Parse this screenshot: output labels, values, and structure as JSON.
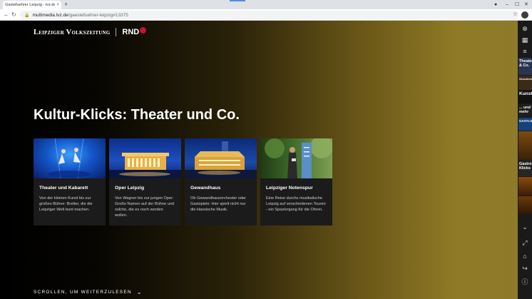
{
  "browser": {
    "tab_title": "Gastefuehrer Leipzig - lvz.de",
    "tab_close": "×",
    "new_tab": "+",
    "url_host": "multimedia.lvz.de",
    "url_path": "/gaestefuehrer-leipzig#13375",
    "icons": {
      "back": "←",
      "reload": "↻",
      "lock": "🔒",
      "star": "☆",
      "minimize": "–",
      "maximize": "☐",
      "close": "✕",
      "record": "●"
    }
  },
  "brand": {
    "lvz": "Leipziger Volkszeitung",
    "rnd": "RND"
  },
  "headline": "Kultur-Klicks: Theater und Co.",
  "cards": [
    {
      "title": "Theater und Kabarett",
      "text": "Von der kleinen Kunst bis zur großen Bühne: Bretter, die die Leipziger Welt bunt machen."
    },
    {
      "title": "Oper Leipzig",
      "text": "Von Wagner bis zur jungen Oper: Große Namen auf der Bühne und solche, die es noch werden wollen."
    },
    {
      "title": "Gewandhaus",
      "text": "Ob Gewandhausorchester oder Gastspiele: Hier spielt nicht nur die klassische Musik."
    },
    {
      "title": "Leipziger Notenspur",
      "text": "Eine Reise durchs musikalische Leipzig auf verschiedenen Touren - ein Spaziergang für die Ohren."
    }
  ],
  "scroll_hint": "SCROLLEN, UM WEITERZULESEN",
  "scroll_chevron": "⌄",
  "sidebar": {
    "top_icons": [
      "⊕",
      "▦",
      "≡"
    ],
    "thumbs": [
      {
        "label": "Theater & Co.",
        "bg": "#2a3550"
      },
      {
        "label": "Geschichte",
        "bg": "#3a2a1a"
      },
      {
        "label": "Kunst",
        "bg": "#111"
      },
      {
        "label": "... und mehr",
        "bg": "#1e1e1e"
      },
      {
        "label": "GASTLICH",
        "bg": "#15427a"
      },
      {
        "label": "",
        "bg": "#5a3a10"
      },
      {
        "label": "Gastro Klicks",
        "bg": "#262626"
      },
      {
        "label": "",
        "bg": "#6a3a0a"
      },
      {
        "label": "",
        "bg": "#4a2a08"
      }
    ],
    "chevron": "⌄",
    "bottom_icons": [
      "⤢",
      "⌂",
      "↪",
      "ⓘ"
    ]
  },
  "colors": {
    "accent_tab": "#4a8fe0",
    "rnd_red": "#c8102e"
  }
}
